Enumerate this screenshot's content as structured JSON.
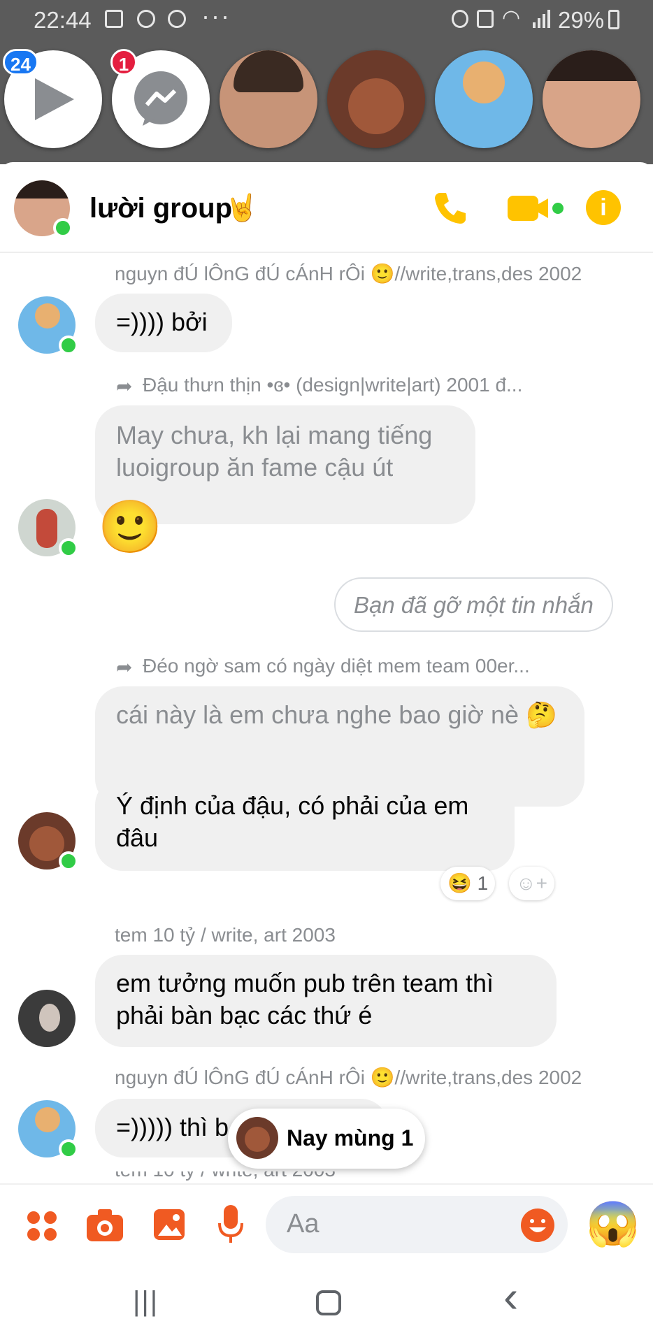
{
  "status_bar": {
    "time": "22:44",
    "battery": "29%",
    "overflow": "···"
  },
  "chat_heads": [
    {
      "name": "video-head",
      "badge": "24",
      "badge_color": "#1877f2"
    },
    {
      "name": "messenger-head",
      "badge": "1",
      "badge_color": "#e41e3f"
    }
  ],
  "header": {
    "title": "lười group",
    "title_emoji": "🤘",
    "accent": "#ffc300"
  },
  "messages": {
    "m1_sender": "nguyn đÚ lÔnG đÚ cÁnH rÔi 🙂//write,trans,des 2002",
    "m1_text": "=)))) bởi",
    "m2_forward": "Đậu thưn thịn •ɞ•  (design|write|art) 2001 đ...",
    "m2_text": "May chưa, kh lại mang tiếng luoigroup ăn fame cậu út",
    "m2_emoji": "🙂",
    "removed": "Bạn đã gỡ một tin nhắn",
    "m3_forward": "Đéo ngờ sam có ngày diệt mem team 00er...",
    "m3_text": "cái này là em chưa nghe bao giờ nè 🤔",
    "m4_text": "Ý định của đậu, có phải của em đâu",
    "m4_reaction": "😆 1",
    "m4_add_reaction": "☺+",
    "m5_sender": "tem 10 tỷ / write, art 2003",
    "m5_text": "em tưởng muốn pub trên team thì phải bàn bạc các thứ é",
    "m6_sender": "nguyn đÚ lÔnG đÚ cÁnH rÔi 🙂//write,trans,des 2002",
    "m6_text": "=))))) thì b",
    "m7_partial": "tem 10 tỷ / write, art 2003"
  },
  "toast": {
    "text": "Nay mùng 1"
  },
  "composer": {
    "placeholder": "Aa",
    "quick_emoji": "😱",
    "accent": "#f05a22"
  },
  "navbar": {
    "recents": "|||",
    "home": "◯",
    "back": "‹"
  }
}
